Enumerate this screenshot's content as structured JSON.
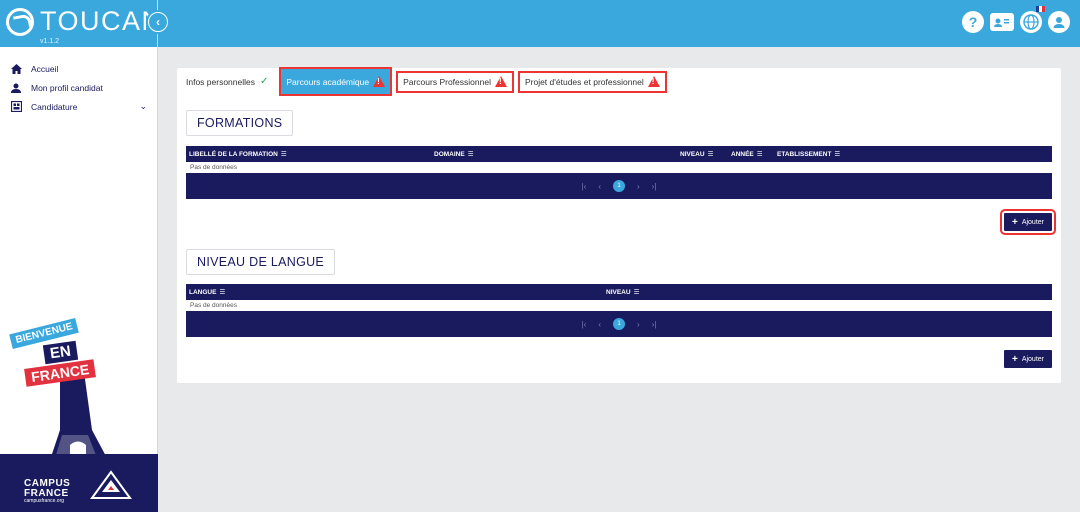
{
  "brand": {
    "name": "TOUCAN",
    "version": "v1.1.2"
  },
  "sidebar": {
    "items": [
      {
        "label": "Accueil"
      },
      {
        "label": "Mon profil candidat"
      },
      {
        "label": "Candidature"
      }
    ],
    "badge": {
      "line1": "BIENVENUE",
      "line2": "EN",
      "line3": "FRANCE"
    },
    "campus": {
      "line1": "CAMPUS",
      "line2": "FRANCE",
      "url": "campusfrance.org"
    }
  },
  "topbar": {
    "help": "?"
  },
  "tabs": [
    {
      "label": "Infos personnelles",
      "status": "ok"
    },
    {
      "label": "Parcours académique",
      "status": "warn"
    },
    {
      "label": "Parcours Professionnel",
      "status": "warn"
    },
    {
      "label": "Projet d'études et professionnel",
      "status": "warn"
    }
  ],
  "formations": {
    "title": "FORMATIONS",
    "columns": [
      "LIBELLÉ DE LA FORMATION",
      "DOMAINE",
      "NIVEAU",
      "ANNÉE",
      "ETABLISSEMENT"
    ],
    "empty": "Pas de données",
    "page": "1",
    "add_label": "Ajouter"
  },
  "langue": {
    "title": "NIVEAU DE LANGUE",
    "columns": [
      "LANGUE",
      "NIVEAU"
    ],
    "empty": "Pas de données",
    "page": "1",
    "add_label": "Ajouter"
  },
  "colors": {
    "primary": "#3aa8dd",
    "navy": "#1a1a5e",
    "alert": "#e33333"
  }
}
